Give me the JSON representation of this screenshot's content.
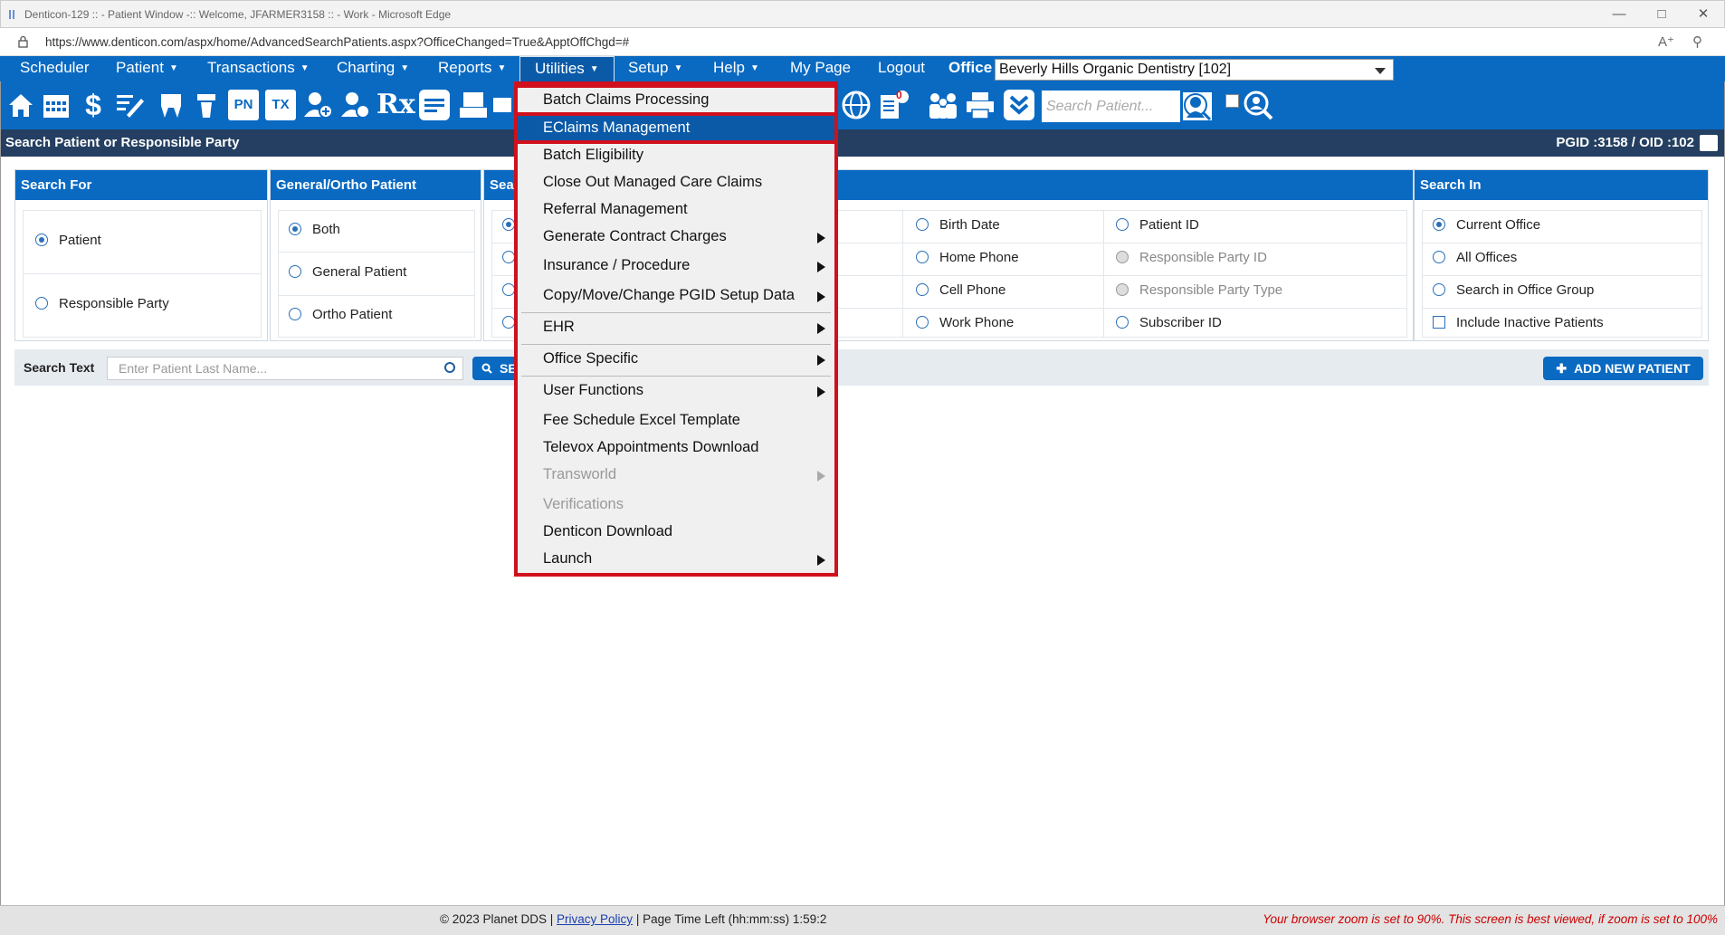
{
  "window": {
    "title": "Denticon-129 :: - Patient Window -:: Welcome, JFARMER3158 :: - Work - Microsoft Edge",
    "url": "https://www.denticon.com/aspx/home/AdvancedSearchPatients.aspx?OfficeChanged=True&ApptOffChgd=#"
  },
  "menu": {
    "items": [
      "Scheduler",
      "Patient",
      "Transactions",
      "Charting",
      "Reports",
      "Utilities",
      "Setup",
      "Help",
      "My Page",
      "Logout"
    ],
    "office_label": "Office",
    "office_value": "Beverly Hills Organic Dentistry [102]"
  },
  "iconbar": {
    "search_placeholder": "Search Patient...",
    "notification_count": "0",
    "icons": [
      "home-icon",
      "calendar-icon",
      "dollar-icon",
      "pencil-icon",
      "tooth-icon",
      "tooth-implant-icon",
      "pn-icon",
      "tx-icon",
      "add-patient-icon",
      "patients-icon",
      "rx-icon",
      "notes-icon",
      "print-doc-icon",
      "mail-icon",
      "globe-icon",
      "claims-icon",
      "family-icon",
      "printer-icon",
      "download-icon"
    ],
    "pn_label": "PN",
    "tx_label": "TX",
    "rx_label": "Rx"
  },
  "header": {
    "title": "Search Patient or Responsible Party",
    "ids": "PGID :3158  /  OID :102"
  },
  "panels": {
    "search_for": {
      "title": "Search For",
      "options": [
        "Patient",
        "Responsible Party"
      ]
    },
    "general_ortho": {
      "title": "General/Ortho Patient",
      "options": [
        "Both",
        "General Patient",
        "Ortho Patient"
      ]
    },
    "search_by": {
      "title": "Sear",
      "col2": [
        "Birth Date",
        "Home Phone",
        "Cell Phone",
        "Work Phone"
      ],
      "col3": [
        "Patient ID",
        "Responsible Party ID",
        "Responsible Party Type",
        "Subscriber ID"
      ]
    },
    "search_in": {
      "title": "Search In",
      "options": [
        "Current Office",
        "All Offices",
        "Search in Office Group",
        "Include Inactive Patients"
      ]
    }
  },
  "search": {
    "label": "Search Text",
    "placeholder": "Enter Patient Last Name...",
    "button": "SE",
    "add_button": "ADD NEW PATIENT"
  },
  "dropdown": {
    "items": [
      "Batch Claims Processing",
      "EClaims Management",
      "Batch Eligibility",
      "Close Out Managed Care Claims",
      "Referral Management",
      "Generate Contract Charges",
      "Insurance / Procedure",
      "Copy/Move/Change PGID Setup Data",
      "EHR",
      "Office Specific",
      "User Functions",
      "Fee Schedule Excel Template",
      "Televox Appointments Download",
      "Transworld",
      "Verifications",
      "Denticon Download",
      "Launch"
    ]
  },
  "footer": {
    "copyright": "© 2023 Planet DDS | ",
    "privacy": "Privacy Policy",
    "time": " | Page Time Left (hh:mm:ss) 1:59:2",
    "warning": "Your browser zoom is set to 90%. This screen is best viewed, if zoom is set to 100%"
  },
  "colors": {
    "brand_blue": "#0a6ac2",
    "header_navy": "#243f61",
    "highlight_red": "#d0101c"
  }
}
